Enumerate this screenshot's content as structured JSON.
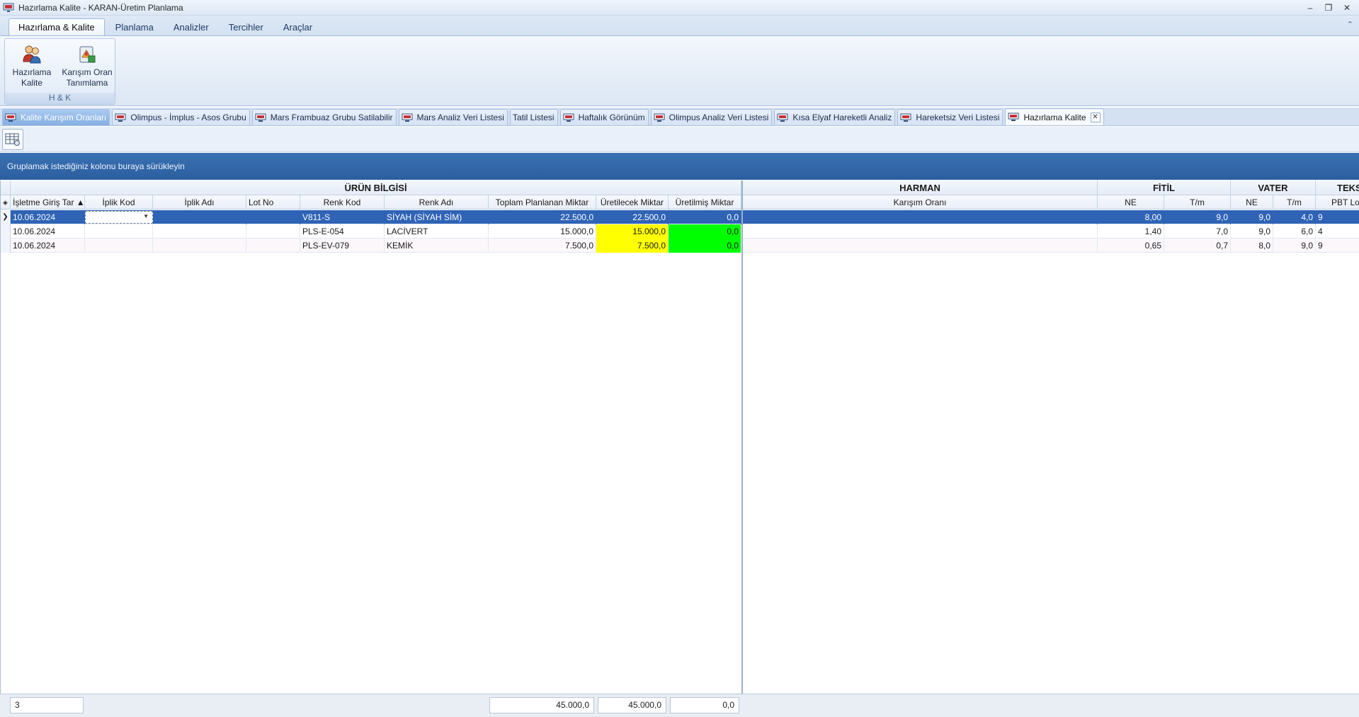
{
  "window": {
    "title": "Hazırlama Kalite - KARAN-Üretim Planlama",
    "controls": [
      "–",
      "❐",
      "✕"
    ]
  },
  "ribbon": {
    "tabs": [
      "Hazırlama & Kalite",
      "Planlama",
      "Analizler",
      "Tercihler",
      "Araçlar"
    ],
    "active_tab": "Hazırlama & Kalite",
    "collapse_glyph": "⌃",
    "group": {
      "label": "H & K",
      "buttons": [
        {
          "line1": "Hazırlama",
          "line2": "Kalite",
          "icon": "users-icon"
        },
        {
          "line1": "Karışım Oran",
          "line2": "Tanımlama",
          "icon": "blend-icon"
        }
      ]
    }
  },
  "doc_tabs": [
    {
      "label": "Kalite Karışım Oranları",
      "state": "highlight"
    },
    {
      "label": "Olimpus - İmplus - Asos Grubu",
      "state": "normal"
    },
    {
      "label": "Mars Frambuaz Grubu Satilabilir",
      "state": "normal"
    },
    {
      "label": "Mars Analiz Veri Listesi",
      "state": "normal"
    },
    {
      "label": "Tatil Listesi",
      "state": "normal"
    },
    {
      "label": "Haftalık Görünüm",
      "state": "normal"
    },
    {
      "label": "Olimpus Analiz Veri Listesi",
      "state": "normal"
    },
    {
      "label": "Kısa Elyaf Hareketli Analiz",
      "state": "normal"
    },
    {
      "label": "Hareketsiz Veri Listesi",
      "state": "normal"
    },
    {
      "label": "Hazırlama Kalite",
      "state": "active"
    }
  ],
  "group_panel_text": "Gruplamak istediğiniz kolonu buraya sürükleyin",
  "grid": {
    "bands": [
      "ÜRÜN BİLGİSİ",
      "HARMAN",
      "FİTİL",
      "VATER",
      "TEKST"
    ],
    "columns": [
      "İşletme Giriş Tar ▲",
      "İplik Kod",
      "İplik Adı",
      "Lot No",
      "Renk Kod",
      "Renk Adı",
      "Toplam Planlanan Miktar",
      "Üretilecek Miktar",
      "Üretilmiş Miktar",
      "Karışım Oranı",
      "NE",
      "T/m",
      "NE",
      "T/m",
      "PBT Lot"
    ],
    "rows": [
      {
        "date": "10.06.2024",
        "iplik_kod": "",
        "iplik_adi": "",
        "lot_no": "",
        "renk_kod": "V811-S",
        "renk_adi": "SİYAH (SİYAH SİM)",
        "toplam": "22.500,0",
        "uretilecek": "22.500,0",
        "uretilmis": "0,0",
        "karisim": "",
        "fitil_ne": "8,00",
        "fitil_tm": "9,0",
        "vater_ne": "9,0",
        "vater_tm": "4,0",
        "pbt": "9"
      },
      {
        "date": "10.06.2024",
        "iplik_kod": "",
        "iplik_adi": "",
        "lot_no": "",
        "renk_kod": "PLS-E-054",
        "renk_adi": "LACİVERT",
        "toplam": "15.000,0",
        "uretilecek": "15.000,0",
        "uretilmis": "0,0",
        "karisim": "",
        "fitil_ne": "1,40",
        "fitil_tm": "7,0",
        "vater_ne": "9,0",
        "vater_tm": "6,0",
        "pbt": "4"
      },
      {
        "date": "10.06.2024",
        "iplik_kod": "",
        "iplik_adi": "",
        "lot_no": "",
        "renk_kod": "PLS-EV-079",
        "renk_adi": "KEMİK",
        "toplam": "7.500,0",
        "uretilecek": "7.500,0",
        "uretilmis": "0,0",
        "karisim": "",
        "fitil_ne": "0,65",
        "fitil_tm": "0,7",
        "vater_ne": "8,0",
        "vater_tm": "9,0",
        "pbt": "9"
      }
    ],
    "selected_row": 0,
    "highlight_colors": {
      "uretilecek": "#ffff00",
      "uretilmis": "#00ff00",
      "selection": "#2f63b5"
    }
  },
  "footer": {
    "count": "3",
    "toplam_sum": "45.000,0",
    "uretilecek_sum": "45.000,0",
    "uretilmis_sum": "0,0"
  },
  "colors": {
    "group_panel": "#2b5e9e",
    "ribbon_bg": "#dbe6f4"
  }
}
